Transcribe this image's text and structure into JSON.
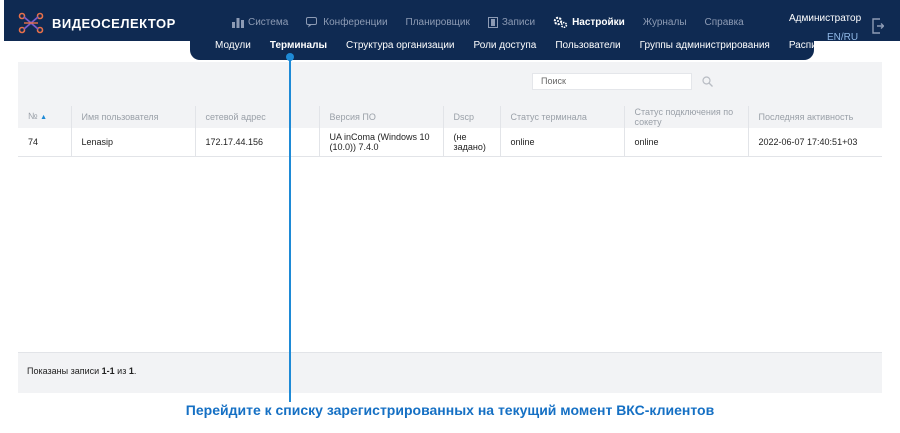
{
  "brand": {
    "name": "ВИДЕОСЕЛЕКТОР"
  },
  "main_menu": [
    {
      "label": "Система",
      "icon": "bar-chart-icon",
      "active": false
    },
    {
      "label": "Конференции",
      "icon": "chat-icon",
      "active": false
    },
    {
      "label": "Планировщик",
      "icon": "",
      "active": false
    },
    {
      "label": "Записи",
      "icon": "film-icon",
      "active": false
    },
    {
      "label": "Настройки",
      "icon": "gears-icon",
      "active": true
    },
    {
      "label": "Журналы",
      "icon": "",
      "active": false
    },
    {
      "label": "Справка",
      "icon": "",
      "active": false
    }
  ],
  "sub_menu": [
    {
      "label": "Модули",
      "active": false
    },
    {
      "label": "Терминалы",
      "active": true
    },
    {
      "label": "Структура организации",
      "active": false
    },
    {
      "label": "Роли доступа",
      "active": false
    },
    {
      "label": "Пользователи",
      "active": false
    },
    {
      "label": "Группы администрирования",
      "active": false
    },
    {
      "label": "Расписание",
      "active": false
    }
  ],
  "user": {
    "name": "Администратор",
    "lang": "EN/RU"
  },
  "search": {
    "placeholder": "Поиск"
  },
  "table": {
    "headers": [
      "№",
      "Имя пользователя",
      "сетевой адрес",
      "Версия ПО",
      "Dscp",
      "Статус терминала",
      "Статус подключения по сокету",
      "Последняя активность"
    ],
    "rows": [
      [
        "74",
        "Lenasip",
        "172.17.44.156",
        "UA inComa (Windows 10 (10.0)) 7.4.0",
        "(не задано)",
        "online",
        "online",
        "2022-06-07 17:40:51+03"
      ]
    ]
  },
  "footer": {
    "prefix": "Показаны записи ",
    "range": "1-1",
    "middle": " из ",
    "total": "1",
    "suffix": "."
  },
  "caption": "Перейдите к списку зарегистрированных на текущий момент ВКС-клиентов",
  "colors": {
    "nav": "#0f2a52",
    "accent": "#1e8ad6",
    "caption": "#1570c4",
    "panel": "#f2f3f5"
  }
}
